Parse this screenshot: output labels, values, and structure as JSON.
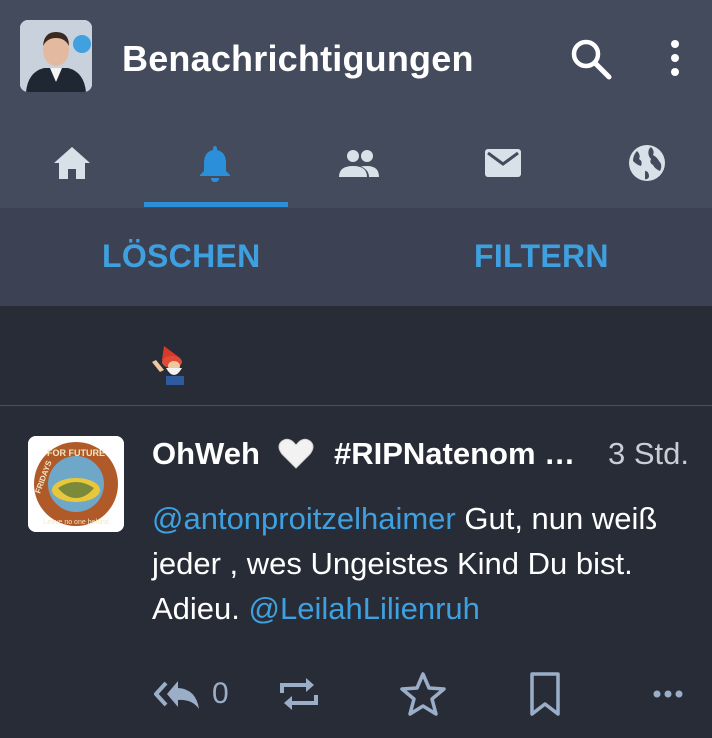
{
  "header": {
    "title": "Benachrichtigungen",
    "avatar_icon": "user-avatar",
    "search_icon": "search-icon",
    "more_icon": "more-vertical-icon"
  },
  "tabs": [
    {
      "name": "home",
      "icon": "home-icon",
      "active": false
    },
    {
      "name": "notifications",
      "icon": "bell-icon",
      "active": true
    },
    {
      "name": "local",
      "icon": "people-icon",
      "active": false
    },
    {
      "name": "direct",
      "icon": "mail-icon",
      "active": false
    },
    {
      "name": "federated",
      "icon": "globe-icon",
      "active": false
    }
  ],
  "actions": {
    "clear_label": "LÖSCHEN",
    "filter_label": "FILTERN"
  },
  "notification": {
    "emoji_icon": "gnome-emoji"
  },
  "status": {
    "display_name": "OhWeh",
    "name_emoji": "🤍",
    "hashtag_text": "#RIPNatenom …",
    "time": "3 Std.",
    "mention1": "@antonproitzelhaimer",
    "text1": " Gut, nun weiß jeder , wes Ungeistes Kind Du bist. Adieu. ",
    "mention2": "@LeilahLilienruh",
    "reply_count": "0",
    "avatar_text": "FRIDAYS FOR FUTURE · Leave no one behind"
  },
  "colors": {
    "accent": "#2b90d9",
    "link": "#3fa0e0",
    "background": "#282c37",
    "topbar": "#444b5d",
    "icon": "#d9e1e8",
    "muted_icon": "#9baec8"
  }
}
